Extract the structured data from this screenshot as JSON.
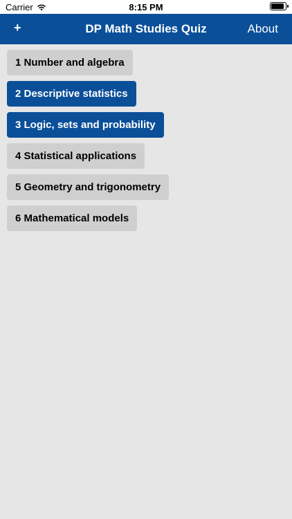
{
  "status_bar": {
    "carrier": "Carrier",
    "time": "8:15 PM"
  },
  "nav": {
    "add_label": "+",
    "title": "DP Math Studies Quiz",
    "about_label": "About"
  },
  "topics": [
    {
      "label": "1 Number and algebra",
      "selected": false
    },
    {
      "label": "2 Descriptive statistics",
      "selected": true
    },
    {
      "label": "3 Logic, sets and probability",
      "selected": true
    },
    {
      "label": "4 Statistical applications",
      "selected": false
    },
    {
      "label": "5 Geometry and trigonometry",
      "selected": false
    },
    {
      "label": "6 Mathematical models",
      "selected": false
    }
  ],
  "colors": {
    "primary": "#0b4f99",
    "background": "#e6e6e6",
    "button_inactive": "#cfcfcf"
  },
  "icons": {
    "wifi": "wifi-icon",
    "battery": "battery-icon"
  }
}
